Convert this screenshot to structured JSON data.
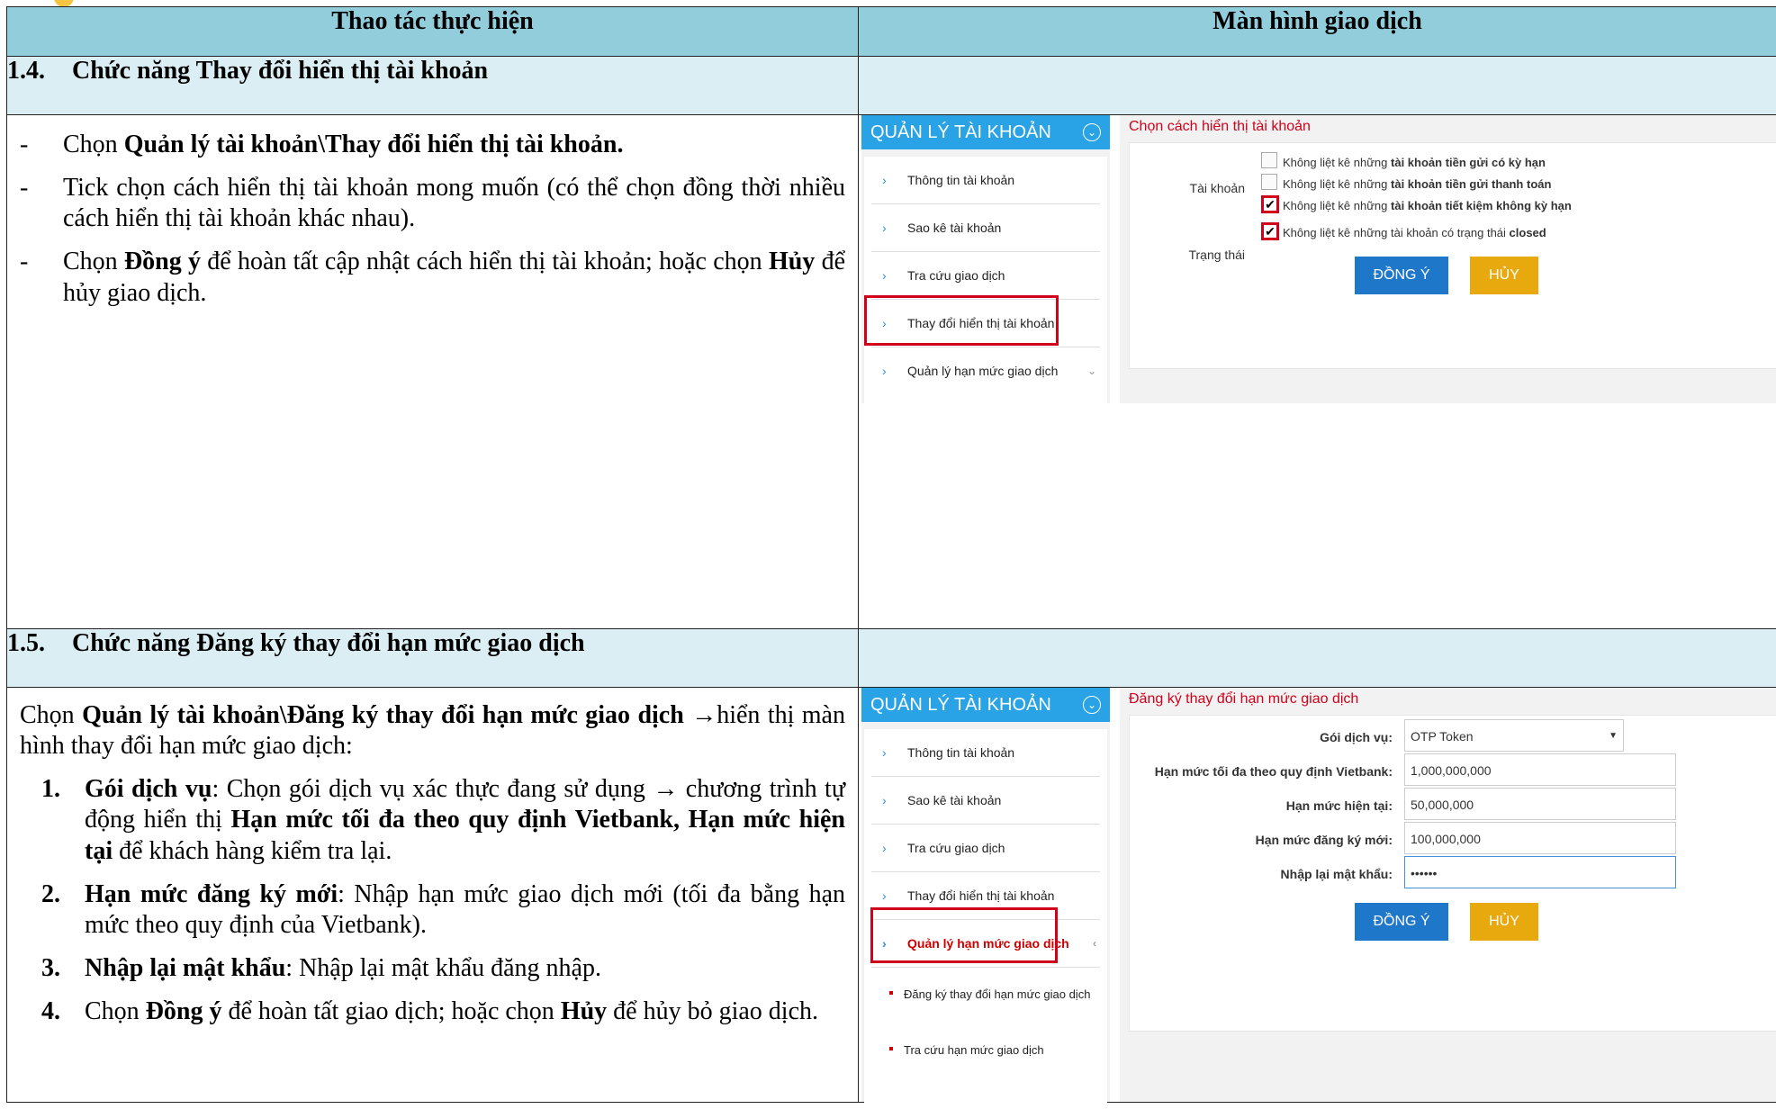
{
  "header": {
    "col1": "Thao tác thực hiện",
    "col2": "Màn hình giao dịch"
  },
  "sec14": {
    "num": "1.4.",
    "title": "Chức năng Thay đổi hiển thị tài khoản",
    "p1_a": "Chọn ",
    "p1_b": "Quản lý tài khoản\\Thay đổi hiển thị tài khoản.",
    "p2": "Tick chọn cách hiển thị tài khoản mong muốn (có thể chọn đồng thời nhiều cách hiển thị tài khoản khác nhau).",
    "p3_a": "Chọn ",
    "p3_b": "Đồng ý",
    "p3_c": " để hoàn tất cập nhật cách hiển thị tài khoản; hoặc chọn ",
    "p3_d": "Hủy",
    "p3_e": " để hủy giao dịch.",
    "ui": {
      "side_title": "QUẢN LÝ TÀI KHOẢN",
      "items": [
        "Thông tin tài khoản",
        "Sao kê tài khoản",
        "Tra cứu giao dịch",
        "Thay đổi hiển thị tài khoản",
        "Quản lý hạn mức giao dịch"
      ],
      "panel_title": "Chọn cách hiển thị tài khoản",
      "label_account": "Tài khoản",
      "label_status": "Trạng thái",
      "cb1_a": "Không liệt kê những ",
      "cb1_b": "tài khoản tiền gửi có kỳ hạn",
      "cb2_a": "Không liệt kê những ",
      "cb2_b": "tài khoản tiền gửi thanh toán",
      "cb3_a": "Không liệt kê những ",
      "cb3_b": "tài khoản tiết kiệm không kỳ hạn",
      "cb4_a": "Không liệt kê những tài khoản có trạng thái ",
      "cb4_b": "closed",
      "ok": "ĐỒNG Ý",
      "cancel": "HỦY"
    }
  },
  "sec15": {
    "num": "1.5.",
    "title": "Chức năng Đăng ký thay đổi hạn mức giao dịch",
    "intro_a": "Chọn ",
    "intro_b": "Quản lý tài khoản\\Đăng ký thay đổi hạn mức giao dịch",
    "intro_c": " →hiển thị màn hình thay đổi hạn mức giao dịch:",
    "i1_n": "1.",
    "i1_a": "Gói dịch vụ",
    "i1_b": ": Chọn gói dịch vụ xác thực đang sử dụng → chương trình tự động hiển thị ",
    "i1_c": "Hạn mức tối đa theo quy định Vietbank, Hạn mức hiện tại",
    "i1_d": " để khách hàng kiểm tra lại.",
    "i2_n": "2.",
    "i2_a": "Hạn mức đăng ký mới",
    "i2_b": ": Nhập hạn mức giao dịch mới (tối đa bằng hạn mức theo quy định của Vietbank).",
    "i3_n": "3.",
    "i3_a": "Nhập lại mật khẩu",
    "i3_b": ": Nhập lại mật khẩu đăng nhập.",
    "i4_n": "4.",
    "i4_a": "Chọn ",
    "i4_b": "Đồng ý",
    "i4_c": " để hoàn tất giao dịch; hoặc chọn ",
    "i4_d": "Hủy",
    "i4_e": " để hủy bỏ giao dịch.",
    "ui": {
      "side_title": "QUẢN LÝ TÀI KHOẢN",
      "items": [
        "Thông tin tài khoản",
        "Sao kê tài khoản",
        "Tra cứu giao dịch",
        "Thay đổi hiển thị tài khoản",
        "Quản lý hạn mức giao dịch"
      ],
      "sub1": "Đăng ký thay đổi hạn mức giao dịch",
      "sub2": "Tra cứu hạn mức giao dịch",
      "panel_title": "Đăng ký thay đổi hạn mức giao dịch",
      "l_pkg": "Gói dịch vụ:",
      "v_pkg": "OTP Token",
      "l_max": "Hạn mức tối đa theo quy định Vietbank:",
      "v_max": "1,000,000,000",
      "l_cur": "Hạn mức hiện tại:",
      "v_cur": "50,000,000",
      "l_new": "Hạn mức đăng ký mới:",
      "v_new": "100,000,000",
      "l_pwd": "Nhập lại mật khẩu:",
      "v_pwd": "••••••",
      "ok": "ĐỒNG Ý",
      "cancel": "HỦY"
    }
  }
}
